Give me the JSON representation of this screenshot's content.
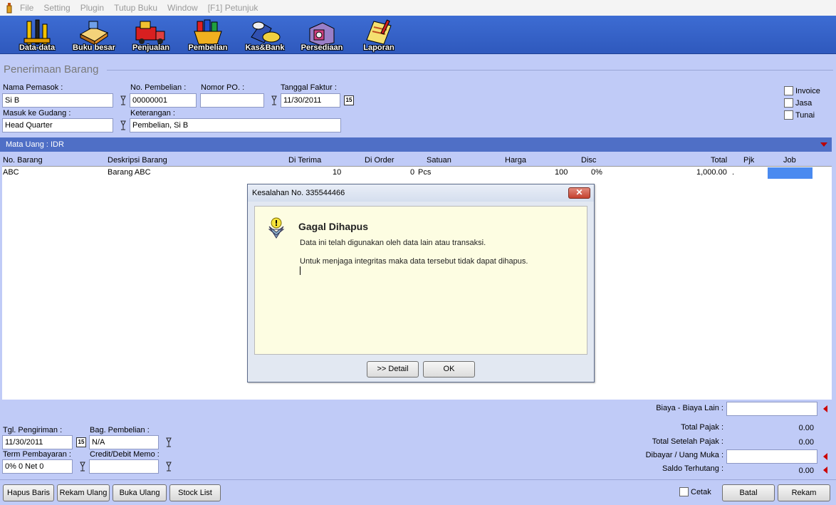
{
  "menu": [
    "File",
    "Setting",
    "Plugin",
    "Tutup Buku",
    "Window",
    "[F1] Petunjuk"
  ],
  "toolbar": [
    {
      "label": "Data-data",
      "icon": "tools-icon"
    },
    {
      "label": "Buku besar",
      "icon": "ledger-book-icon"
    },
    {
      "label": "Penjualan",
      "icon": "delivery-truck-icon"
    },
    {
      "label": "Pembelian",
      "icon": "shopping-basket-icon"
    },
    {
      "label": "Kas&Bank",
      "icon": "cash-bank-icon"
    },
    {
      "label": "Persediaan",
      "icon": "inventory-icon"
    },
    {
      "label": "Laporan",
      "icon": "report-icon"
    }
  ],
  "form": {
    "title": "Penerimaan Barang",
    "supplier_label": "Nama Pemasok :",
    "supplier_value": "Si B",
    "purchase_no_label": "No. Pembelian :",
    "purchase_no_value": "00000001",
    "po_no_label": "Nomor PO. :",
    "po_no_value": "",
    "invoice_date_label": "Tanggal Faktur :",
    "invoice_date_value": "11/30/2011",
    "warehouse_label": "Masuk ke Gudang :",
    "warehouse_value": "Head Quarter",
    "notes_label": "Keterangan :",
    "notes_value": "Pembelian, Si B",
    "checkboxes": [
      "Invoice",
      "Jasa",
      "Tunai"
    ],
    "calendar_glyph": "15"
  },
  "currency": {
    "label": "Mata Uang : IDR"
  },
  "grid": {
    "headers": [
      "No. Barang",
      "Deskripsi Barang",
      "Di Terima",
      "Di Order",
      "Satuan",
      "Harga",
      "Disc",
      "Total",
      "Pjk",
      "Job"
    ],
    "rows": [
      [
        "ABC",
        "Barang ABC",
        "10",
        "0",
        "Pcs",
        "100",
        "0%",
        "1,000.00",
        ".",
        ""
      ]
    ]
  },
  "dialog": {
    "title": "Kesalahan No. 335544466",
    "close": "✕",
    "heading": "Gagal Dihapus",
    "line1": "Data ini telah digunakan oleh data lain atau transaksi.",
    "line2": "Untuk menjaga integritas maka data tersebut tidak dapat dihapus.",
    "detail_button": ">> Detail",
    "ok_button": "OK"
  },
  "footer": {
    "ship_date_label": "Tgl. Pengiriman :",
    "ship_date_value": "11/30/2011",
    "purchasing_label": "Bag. Pembelian :",
    "purchasing_value": "N/A",
    "term_label": "Term Pembayaran :",
    "term_value": "0% 0 Net 0",
    "memo_label": "Credit/Debit Memo :",
    "memo_value": "",
    "other_costs_label": "Biaya - Biaya Lain :",
    "other_costs_value": "",
    "total_tax_label": "Total Pajak :",
    "total_tax_value": "0.00",
    "total_after_tax_label": "Total Setelah Pajak :",
    "total_after_tax_value": "0.00",
    "paid_label": "Dibayar / Uang Muka :",
    "paid_value": "",
    "balance_label": "Saldo Terhutang :",
    "balance_value": "0.00",
    "print_label": "Cetak"
  },
  "buttons": {
    "delete_row": "Hapus Baris",
    "save_again": "Rekam Ulang",
    "reopen": "Buka Ulang",
    "stock_list": "Stock List",
    "cancel": "Batal",
    "save": "Rekam"
  }
}
